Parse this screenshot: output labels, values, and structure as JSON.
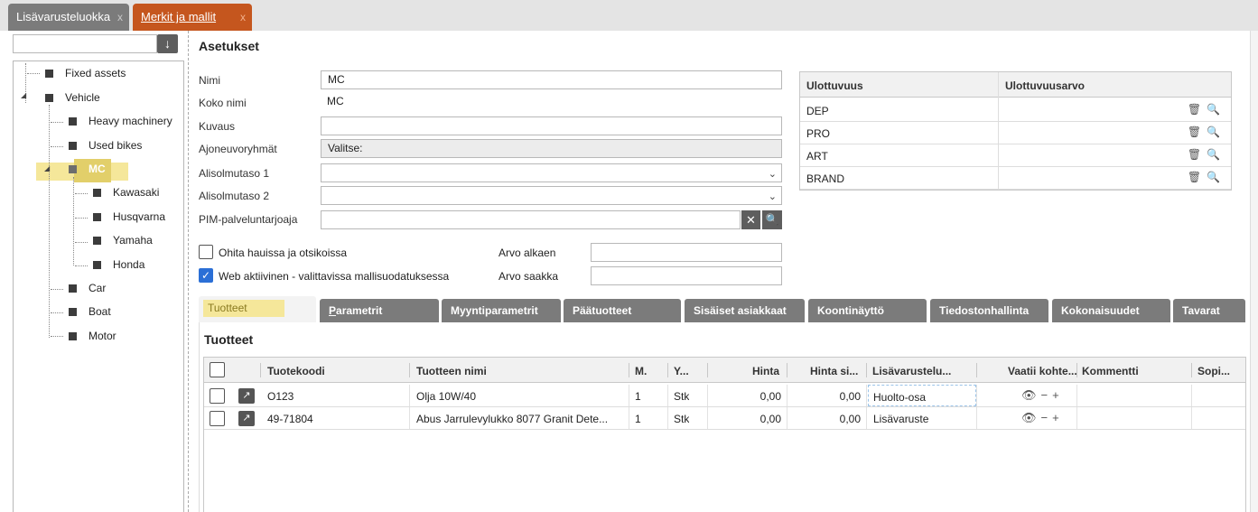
{
  "doc_tabs": [
    {
      "label": "Lisävarusteluokka",
      "close": "x"
    },
    {
      "label": "Merkit ja mallit",
      "close": "x"
    }
  ],
  "tree": {
    "items": [
      {
        "label": "Fixed assets"
      },
      {
        "label": "Vehicle"
      },
      {
        "label": "Heavy machinery"
      },
      {
        "label": "Used bikes"
      },
      {
        "label": "MC"
      },
      {
        "label": "Kawasaki"
      },
      {
        "label": "Husqvarna"
      },
      {
        "label": "Yamaha"
      },
      {
        "label": "Honda"
      },
      {
        "label": "Car"
      },
      {
        "label": "Boat"
      },
      {
        "label": "Motor"
      }
    ]
  },
  "settings": {
    "title": "Asetukset",
    "fields": {
      "nimi": {
        "label": "Nimi",
        "value": "MC"
      },
      "koko_nimi": {
        "label": "Koko nimi",
        "value": "MC"
      },
      "kuvaus": {
        "label": "Kuvaus",
        "value": ""
      },
      "ajoneuvoryhmat": {
        "label": "Ajoneuvoryhmät",
        "value": "Valitse:"
      },
      "alisolmutaso1": {
        "label": "Alisolmutaso 1",
        "value": ""
      },
      "alisolmutaso2": {
        "label": "Alisolmutaso 2",
        "value": ""
      },
      "pim": {
        "label": "PIM-palveluntarjoaja",
        "value": ""
      }
    },
    "ohita_label": "Ohita hauissa ja otsikoissa",
    "web_label": "Web aktiivinen - valittavissa mallisuodatuksessa",
    "arvo_alkaen_label": "Arvo alkaen",
    "arvo_saakka_label": "Arvo saakka",
    "web_checked": true,
    "ohita_checked": false
  },
  "dimensions": {
    "headers": [
      "Ulottuvuus",
      "Ulottuvuusarvo"
    ],
    "rows": [
      {
        "code": "DEP"
      },
      {
        "code": "PRO"
      },
      {
        "code": "ART"
      },
      {
        "code": "BRAND"
      }
    ]
  },
  "sub_tabs": [
    "Tuotteet",
    "Parametrit",
    "Myyntiparametrit",
    "Päätuotteet",
    "Sisäiset asiakkaat",
    "Koontinäyttö",
    "Tiedostonhallinta",
    "Kokonaisuudet",
    "Tavarat"
  ],
  "products": {
    "title": "Tuotteet",
    "columns": [
      "Tuotekoodi",
      "Tuotteen nimi",
      "M.",
      "Y...",
      "Hinta",
      "Hinta si...",
      "Lisävarustelu...",
      "Vaatii kohte...",
      "Kommentti",
      "Sopi..."
    ],
    "rows": [
      {
        "code": "O123",
        "name": "Olja 10W/40",
        "m": "1",
        "y": "Stk",
        "hinta": "0,00",
        "hinta_si": "0,00",
        "lisa": "Huolto-osa"
      },
      {
        "code": "49-71804",
        "name": "Abus Jarrulevylukko 8077 Granit Dete...",
        "m": "1",
        "y": "Stk",
        "hinta": "0,00",
        "hinta_si": "0,00",
        "lisa": "Lisävaruste"
      }
    ]
  }
}
